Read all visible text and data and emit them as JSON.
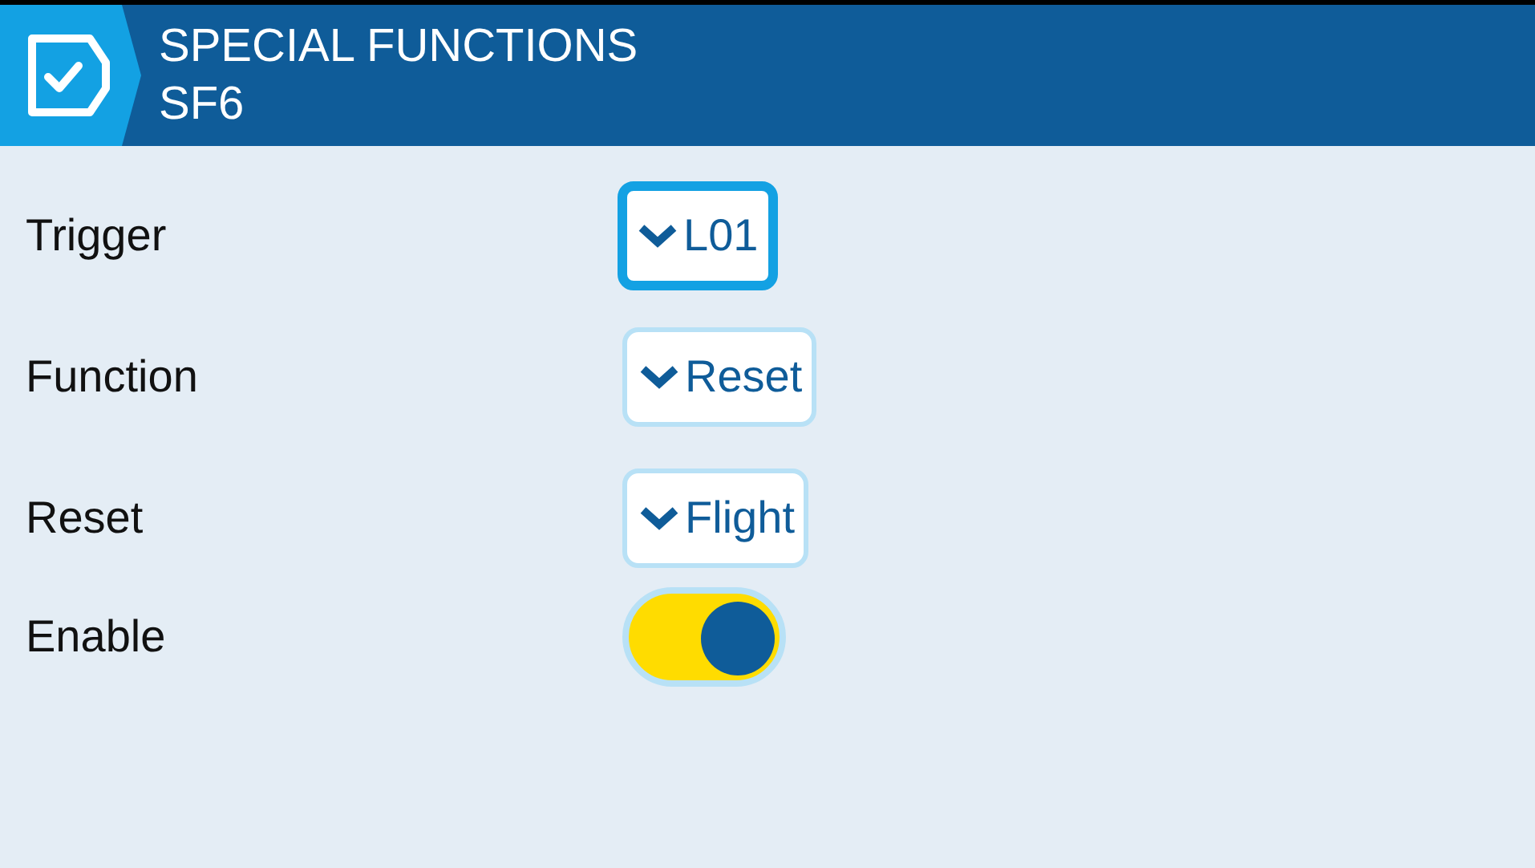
{
  "header": {
    "title": "SPECIAL FUNCTIONS",
    "subtitle": "SF6"
  },
  "rows": [
    {
      "label": "Trigger",
      "kind": "dropdown",
      "value": "L01",
      "focused": true
    },
    {
      "label": "Function",
      "kind": "dropdown",
      "value": "Reset",
      "focused": false
    },
    {
      "label": "Reset",
      "kind": "dropdown",
      "value": "Flight",
      "focused": false
    },
    {
      "label": "Enable",
      "kind": "toggle",
      "on": true
    }
  ]
}
